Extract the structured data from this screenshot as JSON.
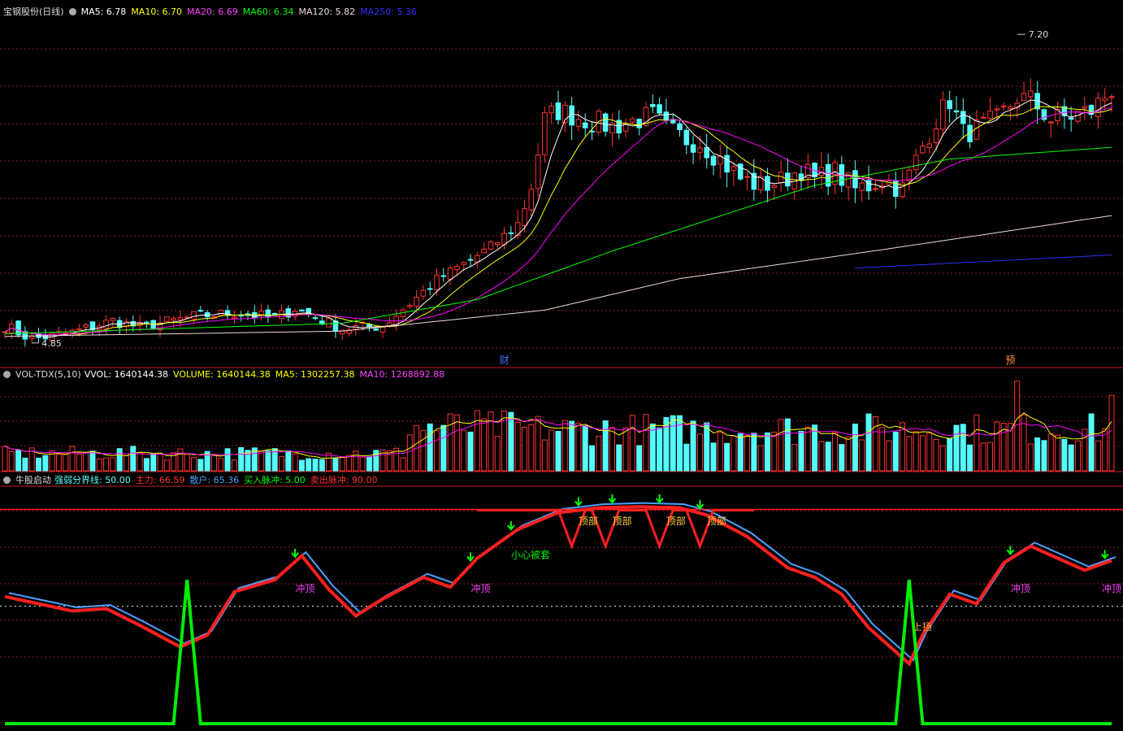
{
  "colors": {
    "up": "#ff3232",
    "down": "#54fcfc",
    "ma5": "#ffffff",
    "ma10": "#ffff00",
    "ma20": "#ff00ff",
    "ma60": "#00ff00",
    "ma120": "#f0d8d8",
    "ma250": "#3030ff",
    "grid": "#8b1a1a",
    "zhuli": "#ff2020",
    "sanhu": "#4aa0ff",
    "pulse": "#00ee00",
    "mark": "#ff40ff"
  },
  "price_panel": {
    "title": "宝钢股份(日线)",
    "mas": [
      {
        "label": "MA5: 6.78",
        "color": "#ffffff"
      },
      {
        "label": "MA10: 6.70",
        "color": "#ffff00"
      },
      {
        "label": "MA20: 6.69",
        "color": "#ff40ff"
      },
      {
        "label": "MA60: 6.34",
        "color": "#00ff00"
      },
      {
        "label": "MA120: 5.82",
        "color": "#f0d8d8"
      },
      {
        "label": "MA250: 5.36",
        "color": "#3030ff"
      }
    ],
    "high_label": "7.20",
    "low_label": "4.85",
    "markers": [
      "财",
      "预"
    ]
  },
  "volume_panel": {
    "title": "VOL-TDX(5,10)",
    "items": [
      {
        "label": "VVOL: 1640144.38",
        "color": "#ffffff"
      },
      {
        "label": "VOLUME: 1640144.38",
        "color": "#ffff00"
      },
      {
        "label": "MA5: 1302257.38",
        "color": "#ffff00"
      },
      {
        "label": "MA10: 1268892.88",
        "color": "#ff40ff"
      }
    ]
  },
  "indicator_panel": {
    "title": "牛股启动",
    "items": [
      {
        "label": "强弱分界线: 50.00",
        "color": "#54fcfc"
      },
      {
        "label": "主力: 66.59",
        "color": "#ff3030"
      },
      {
        "label": "散户: 65.36",
        "color": "#4aa0ff"
      },
      {
        "label": "买入脉冲: 5.00",
        "color": "#00ff00"
      },
      {
        "label": "卖出脉冲: 90.00",
        "color": "#ff3030"
      }
    ],
    "annotations": {
      "top": "顶部",
      "careful": "小心被套",
      "rush": "冲顶",
      "rise": "上扬"
    }
  },
  "chart_data": {
    "type": "candlestick",
    "n": 165,
    "ylim": [
      4.7,
      7.35
    ],
    "high": {
      "index": 150,
      "value": 7.2
    },
    "low": {
      "index": 4,
      "value": 4.85
    },
    "anchors": [
      [
        0,
        4.98
      ],
      [
        4,
        4.88
      ],
      [
        10,
        4.93
      ],
      [
        16,
        5.02
      ],
      [
        20,
        4.97
      ],
      [
        28,
        5.05
      ],
      [
        34,
        5.08
      ],
      [
        40,
        5.04
      ],
      [
        43,
        5.11
      ],
      [
        47,
        5.02
      ],
      [
        50,
        4.96
      ],
      [
        56,
        4.98
      ],
      [
        60,
        5.15
      ],
      [
        64,
        5.33
      ],
      [
        68,
        5.45
      ],
      [
        72,
        5.58
      ],
      [
        76,
        5.75
      ],
      [
        78,
        6.05
      ],
      [
        80,
        6.55
      ],
      [
        82,
        6.62
      ],
      [
        86,
        6.55
      ],
      [
        90,
        6.5
      ],
      [
        96,
        6.58
      ],
      [
        98,
        6.48
      ],
      [
        101,
        6.4
      ],
      [
        103,
        6.38
      ],
      [
        106,
        6.25
      ],
      [
        109,
        6.1
      ],
      [
        112,
        6.05
      ],
      [
        115,
        6.08
      ],
      [
        118,
        6.18
      ],
      [
        120,
        6.09
      ],
      [
        123,
        6.15
      ],
      [
        126,
        6.02
      ],
      [
        128,
        6.05
      ],
      [
        130,
        6.1
      ],
      [
        133,
        6.02
      ],
      [
        136,
        6.35
      ],
      [
        138,
        6.55
      ],
      [
        140,
        6.7
      ],
      [
        142,
        6.45
      ],
      [
        144,
        6.48
      ],
      [
        147,
        6.55
      ],
      [
        150,
        6.72
      ],
      [
        152,
        6.7
      ],
      [
        155,
        6.55
      ],
      [
        158,
        6.58
      ],
      [
        161,
        6.62
      ],
      [
        164,
        6.78
      ]
    ],
    "ma60_anchors": [
      [
        0,
        4.92
      ],
      [
        50,
        5.0
      ],
      [
        70,
        5.18
      ],
      [
        90,
        5.55
      ],
      [
        120,
        6.05
      ],
      [
        140,
        6.25
      ],
      [
        164,
        6.34
      ]
    ],
    "ma120_anchors": [
      [
        0,
        4.9
      ],
      [
        50,
        4.94
      ],
      [
        80,
        5.1
      ],
      [
        100,
        5.34
      ],
      [
        130,
        5.56
      ],
      [
        164,
        5.82
      ]
    ],
    "ma250_anchors": [
      [
        126,
        5.42
      ],
      [
        164,
        5.52
      ]
    ],
    "volume": {
      "ylim": [
        0,
        2000000
      ],
      "last": 1640144.38
    },
    "indicator": {
      "ylim": [
        0,
        100
      ],
      "threshold": 50,
      "sell_level": 90,
      "zhuli_anchors": [
        [
          0,
          54
        ],
        [
          10,
          48
        ],
        [
          15,
          49
        ],
        [
          20,
          42
        ],
        [
          26,
          33
        ],
        [
          30,
          38
        ],
        [
          34,
          56
        ],
        [
          40,
          61
        ],
        [
          44,
          71
        ],
        [
          48,
          57
        ],
        [
          52,
          46
        ],
        [
          56,
          53
        ],
        [
          62,
          62
        ],
        [
          66,
          58
        ],
        [
          70,
          70
        ],
        [
          76,
          82
        ],
        [
          82,
          89
        ],
        [
          88,
          91
        ],
        [
          94,
          91.5
        ],
        [
          100,
          91
        ],
        [
          104,
          88
        ],
        [
          110,
          79
        ],
        [
          116,
          66
        ],
        [
          120,
          62
        ],
        [
          124,
          55
        ],
        [
          128,
          41
        ],
        [
          132,
          31
        ],
        [
          134,
          26
        ],
        [
          136,
          38
        ],
        [
          140,
          55
        ],
        [
          144,
          51
        ],
        [
          148,
          68
        ],
        [
          152,
          75
        ],
        [
          156,
          70
        ],
        [
          160,
          65
        ],
        [
          164,
          69
        ]
      ],
      "buy_pulse_idx": [
        27,
        134
      ],
      "sell_pulse_idx": [
        84,
        89,
        97,
        103
      ],
      "top_labels_idx": [
        85,
        90,
        98,
        104
      ],
      "rush_labels_idx": [
        44,
        70,
        150,
        164
      ],
      "down_arrows_idx": [
        43,
        69,
        75,
        85,
        90,
        97,
        103,
        149,
        163
      ]
    }
  }
}
